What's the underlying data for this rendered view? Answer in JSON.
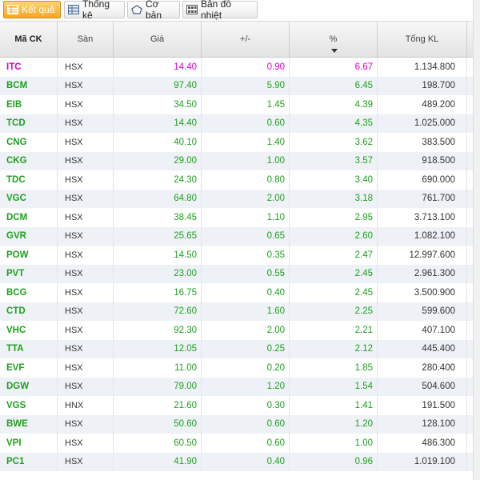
{
  "tabs": [
    {
      "label": "Kết quả",
      "icon": "table-icon",
      "active": true
    },
    {
      "label": "Thống kê",
      "icon": "stats-grid-icon",
      "active": false
    },
    {
      "label": "Cơ bản",
      "icon": "pentagon-icon",
      "active": false
    },
    {
      "label": "Bản đồ nhiệt",
      "icon": "heatmap-icon",
      "active": false
    }
  ],
  "columns": [
    "Mã CK",
    "Sàn",
    "Giá",
    "+/-",
    "%",
    "Tổng KL"
  ],
  "sort_column": "%",
  "colors": {
    "up": "#1ea01e",
    "ceiling": "#e000c8",
    "header_bg": "#e9e9e9",
    "row_alt": "#eef2f6"
  },
  "rows": [
    {
      "code": "ITC",
      "exchange": "HSX",
      "price": "14.40",
      "change": "0.90",
      "pct": "6.67",
      "volume": "1.134.800",
      "status": "ceiling"
    },
    {
      "code": "BCM",
      "exchange": "HSX",
      "price": "97.40",
      "change": "5.90",
      "pct": "6.45",
      "volume": "198.700",
      "status": "up"
    },
    {
      "code": "EIB",
      "exchange": "HSX",
      "price": "34.50",
      "change": "1.45",
      "pct": "4.39",
      "volume": "489.200",
      "status": "up"
    },
    {
      "code": "TCD",
      "exchange": "HSX",
      "price": "14.40",
      "change": "0.60",
      "pct": "4.35",
      "volume": "1.025.000",
      "status": "up"
    },
    {
      "code": "CNG",
      "exchange": "HSX",
      "price": "40.10",
      "change": "1.40",
      "pct": "3.62",
      "volume": "383.500",
      "status": "up"
    },
    {
      "code": "CKG",
      "exchange": "HSX",
      "price": "29.00",
      "change": "1.00",
      "pct": "3.57",
      "volume": "918.500",
      "status": "up"
    },
    {
      "code": "TDC",
      "exchange": "HSX",
      "price": "24.30",
      "change": "0.80",
      "pct": "3.40",
      "volume": "690.000",
      "status": "up"
    },
    {
      "code": "VGC",
      "exchange": "HSX",
      "price": "64.80",
      "change": "2.00",
      "pct": "3.18",
      "volume": "761.700",
      "status": "up"
    },
    {
      "code": "DCM",
      "exchange": "HSX",
      "price": "38.45",
      "change": "1.10",
      "pct": "2.95",
      "volume": "3.713.100",
      "status": "up"
    },
    {
      "code": "GVR",
      "exchange": "HSX",
      "price": "25.65",
      "change": "0.65",
      "pct": "2.60",
      "volume": "1.082.100",
      "status": "up"
    },
    {
      "code": "POW",
      "exchange": "HSX",
      "price": "14.50",
      "change": "0.35",
      "pct": "2.47",
      "volume": "12.997.600",
      "status": "up"
    },
    {
      "code": "PVT",
      "exchange": "HSX",
      "price": "23.00",
      "change": "0.55",
      "pct": "2.45",
      "volume": "2.961.300",
      "status": "up"
    },
    {
      "code": "BCG",
      "exchange": "HSX",
      "price": "16.75",
      "change": "0.40",
      "pct": "2.45",
      "volume": "3.500.900",
      "status": "up"
    },
    {
      "code": "CTD",
      "exchange": "HSX",
      "price": "72.60",
      "change": "1.60",
      "pct": "2.25",
      "volume": "599.600",
      "status": "up"
    },
    {
      "code": "VHC",
      "exchange": "HSX",
      "price": "92.30",
      "change": "2.00",
      "pct": "2.21",
      "volume": "407.100",
      "status": "up"
    },
    {
      "code": "TTA",
      "exchange": "HSX",
      "price": "12.05",
      "change": "0.25",
      "pct": "2.12",
      "volume": "445.400",
      "status": "up"
    },
    {
      "code": "EVF",
      "exchange": "HSX",
      "price": "11.00",
      "change": "0.20",
      "pct": "1.85",
      "volume": "280.400",
      "status": "up"
    },
    {
      "code": "DGW",
      "exchange": "HSX",
      "price": "79.00",
      "change": "1.20",
      "pct": "1.54",
      "volume": "504.600",
      "status": "up"
    },
    {
      "code": "VGS",
      "exchange": "HNX",
      "price": "21.60",
      "change": "0.30",
      "pct": "1.41",
      "volume": "191.500",
      "status": "up"
    },
    {
      "code": "BWE",
      "exchange": "HSX",
      "price": "50.60",
      "change": "0.60",
      "pct": "1.20",
      "volume": "128.100",
      "status": "up"
    },
    {
      "code": "VPI",
      "exchange": "HSX",
      "price": "60.50",
      "change": "0.60",
      "pct": "1.00",
      "volume": "486.300",
      "status": "up"
    },
    {
      "code": "PC1",
      "exchange": "HSX",
      "price": "41.90",
      "change": "0.40",
      "pct": "0.96",
      "volume": "1.019.100",
      "status": "up"
    }
  ]
}
